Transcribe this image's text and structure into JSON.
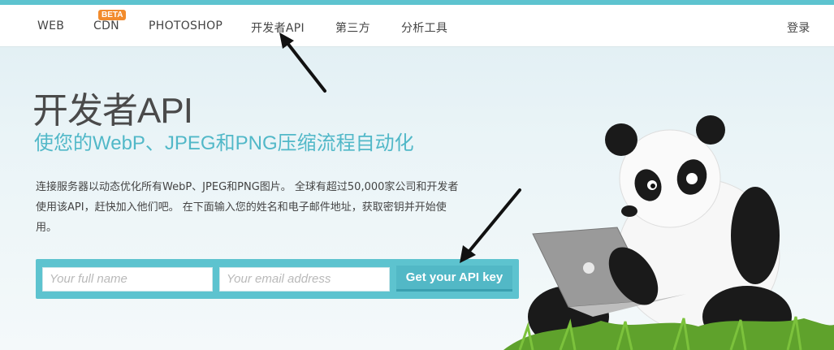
{
  "nav": {
    "items": [
      {
        "label": "WEB"
      },
      {
        "label": "CDN",
        "badge": "BETA"
      },
      {
        "label": "PHOTOSHOP"
      },
      {
        "label": "开发者API"
      },
      {
        "label": "第三方"
      },
      {
        "label": "分析工具"
      }
    ],
    "login": "登录"
  },
  "hero": {
    "title": "开发者API",
    "subtitle": "使您的WebP、JPEG和PNG压缩流程自动化",
    "description": "连接服务器以动态优化所有WebP、JPEG和PNG图片。 全球有超过50,000家公司和开发者使用该API，赶快加入他们吧。 在下面输入您的姓名和电子邮件地址，获取密钥并开始使用。"
  },
  "form": {
    "name_placeholder": "Your full name",
    "email_placeholder": "Your email address",
    "submit_label": "Get your API key"
  },
  "colors": {
    "accent": "#5dc3cf",
    "subtitle": "#51b8c8",
    "badge": "#f28b2c"
  },
  "illustration": {
    "icon": "panda-with-laptop-icon"
  }
}
